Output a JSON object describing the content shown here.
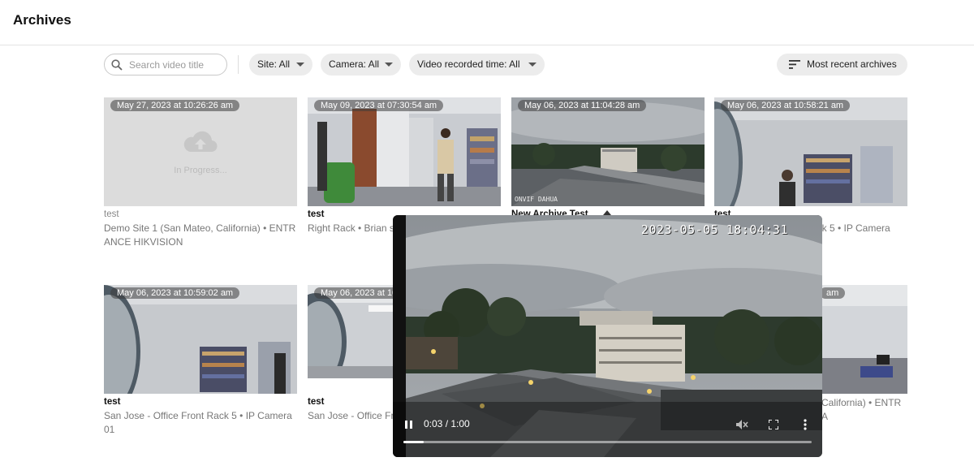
{
  "header": {
    "title": "Archives"
  },
  "search": {
    "placeholder": "Search video title",
    "value": ""
  },
  "filters": {
    "site": "Site: All",
    "camera": "Camera: All",
    "recorded_time": "Video recorded time: All"
  },
  "sort": {
    "label": "Most recent archives"
  },
  "cards": [
    {
      "timestamp": "May 27, 2023 at 10:26:26 am",
      "title": "test",
      "desc": "Demo Site 1 (San Mateo, California) • ENTRANCE HIKVISION",
      "status": "In Progress..."
    },
    {
      "timestamp": "May 09, 2023 at 07:30:54 am",
      "title": "test",
      "desc": "Right Rack • Brian s"
    },
    {
      "timestamp": "May 06, 2023 at 11:04:28 am",
      "title": "New Archive Test",
      "desc": "",
      "overlay_text": "ONVIF DAHUA"
    },
    {
      "timestamp": "May 06, 2023 at 10:58:21 am",
      "title": "test",
      "desc": "ack 5 • IP Camera"
    },
    {
      "timestamp": "May 06, 2023 at 10:59:02 am",
      "title": "test",
      "desc": "San Jose - Office Front Rack 5 • IP Camera 01"
    },
    {
      "timestamp": "May 06, 2023 at 10",
      "title": "test",
      "desc": "San Jose - Office Fr 01"
    },
    {
      "timestamp": "am",
      "title": "",
      "desc": "California) • ENTRA"
    }
  ],
  "player": {
    "osd_timestamp": "2023-05-05 18:04:31",
    "time_display": "0:03 / 1:00",
    "progress": 0.05
  }
}
